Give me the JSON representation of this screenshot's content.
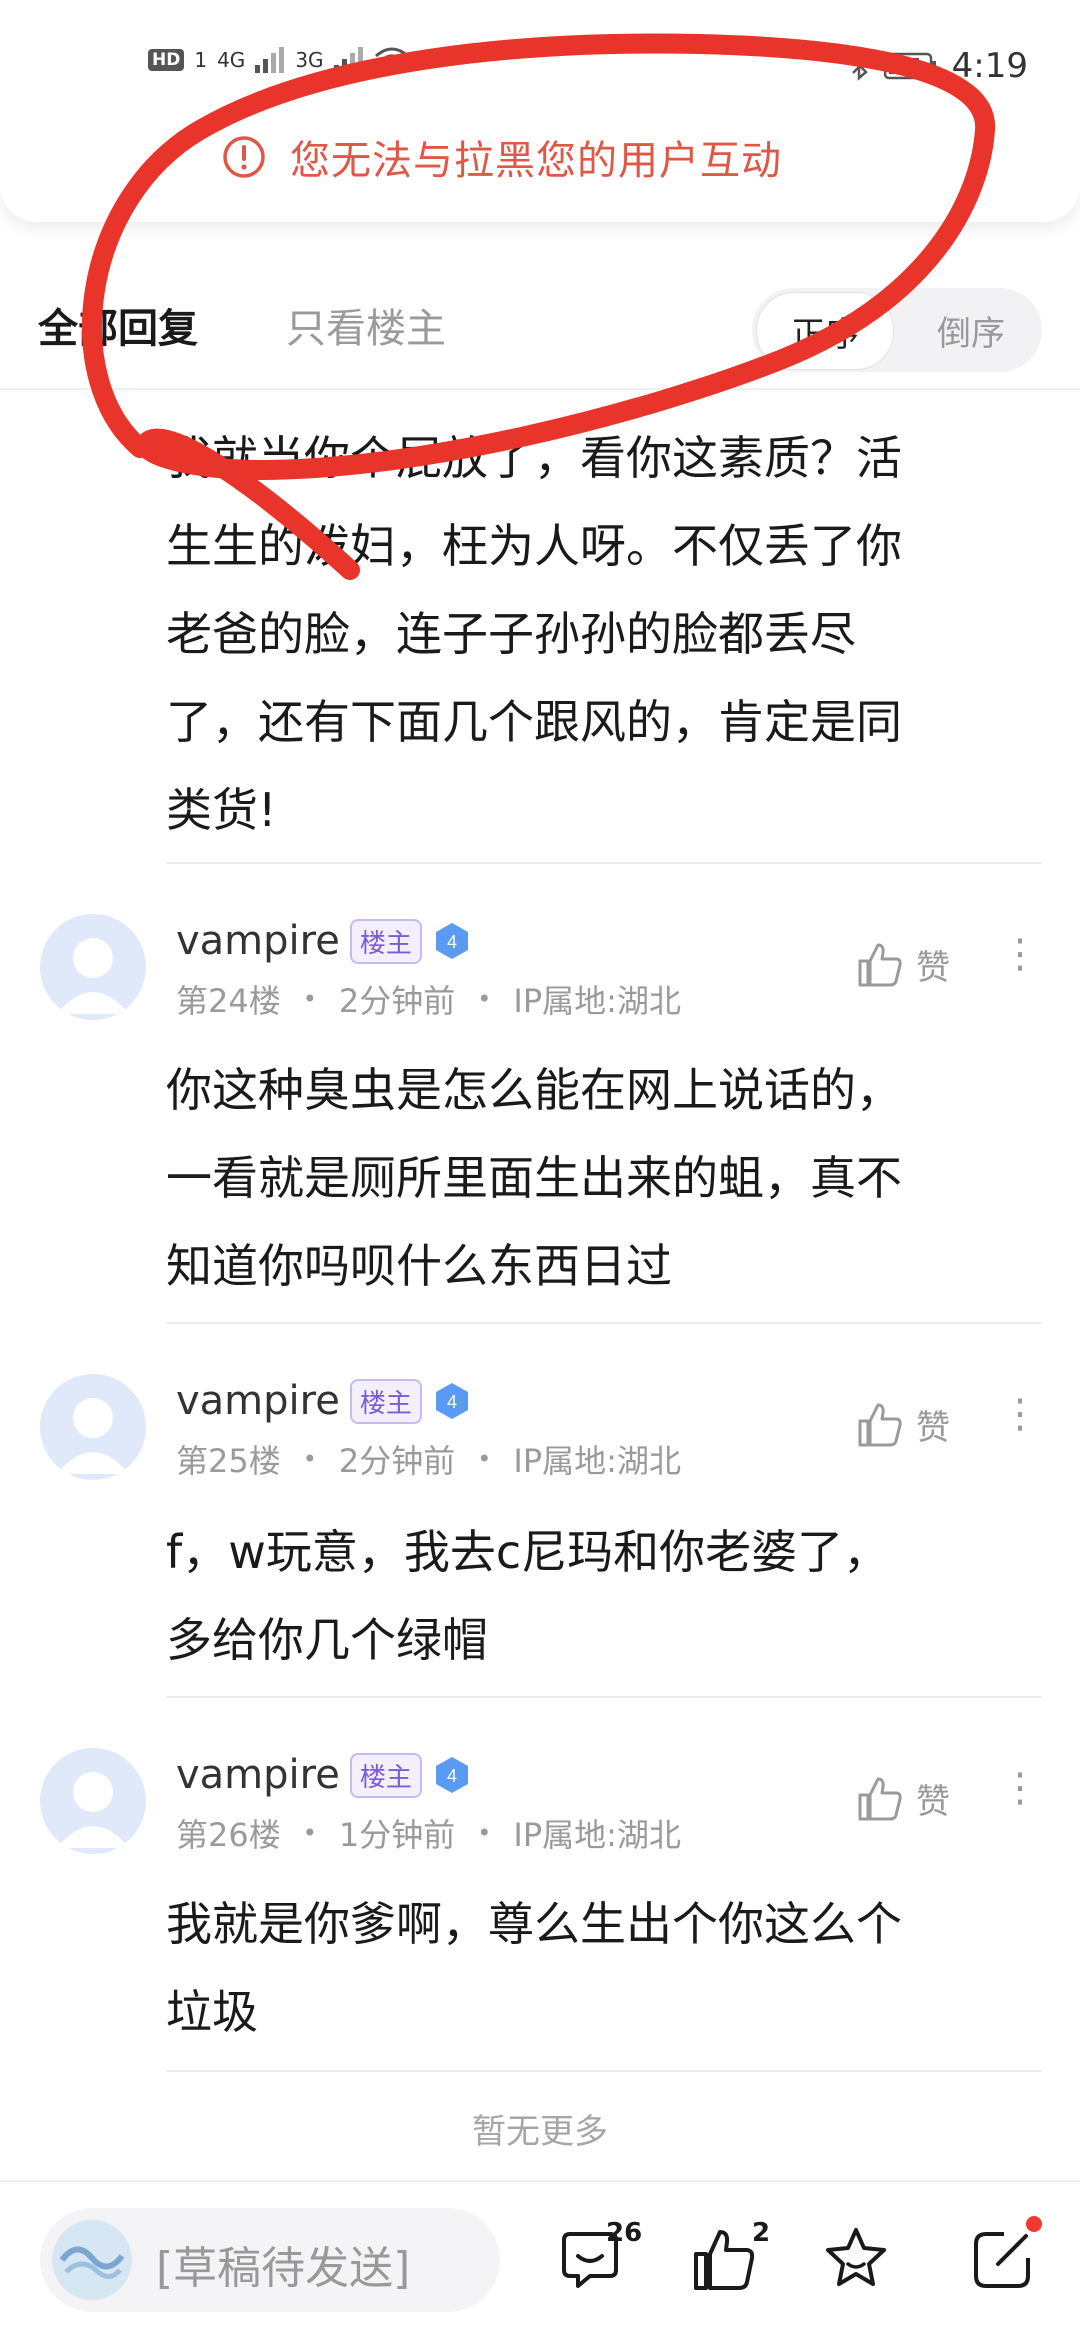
{
  "status_bar": {
    "time": "4:19",
    "network1": "4G",
    "network2": "3G",
    "hd": "HD",
    "sim": "1"
  },
  "toast": {
    "message": "您无法与拉黑您的用户互动",
    "icon": "warning-circle-icon",
    "color": "#e05745"
  },
  "tabs": {
    "all": "全部回复",
    "op_only": "只看楼主",
    "order_asc": "正序",
    "order_desc": "倒序"
  },
  "prev_comment": {
    "lines": [
      "我就当你个屁放了，看你这素质？活",
      "生生的泼妇，枉为人呀。不仅丢了你",
      "老爸的脸，连子子孙孙的脸都丢尽",
      "了，还有下面几个跟风的，肯定是同",
      "类货!"
    ]
  },
  "replies": [
    {
      "username": "vampire",
      "badge": "楼主",
      "level": "4",
      "floor": "第24楼",
      "time": "2分钟前",
      "ip": "IP属地:湖北",
      "like": "赞",
      "lines": [
        "你这种臭虫是怎么能在网上说话的，",
        "一看就是厕所里面生出来的蛆，真不",
        "知道你吗呗什么东西日过"
      ]
    },
    {
      "username": "vampire",
      "badge": "楼主",
      "level": "4",
      "floor": "第25楼",
      "time": "2分钟前",
      "ip": "IP属地:湖北",
      "like": "赞",
      "lines": [
        "f，w玩意，我去c尼玛和你老婆了，",
        "多给你几个绿帽"
      ]
    },
    {
      "username": "vampire",
      "badge": "楼主",
      "level": "4",
      "floor": "第26楼",
      "time": "1分钟前",
      "ip": "IP属地:湖北",
      "like": "赞",
      "lines": [
        "我就是你爹啊，尊么生出个你这么个",
        "垃圾"
      ]
    }
  ],
  "no_more": "暂无更多",
  "bottom_bar": {
    "draft_placeholder": "[草稿待发送]",
    "comment_count": "26",
    "like_count": "2"
  },
  "colors": {
    "annotation_red": "#e8342a",
    "accent_blue": "#4a8df0"
  }
}
